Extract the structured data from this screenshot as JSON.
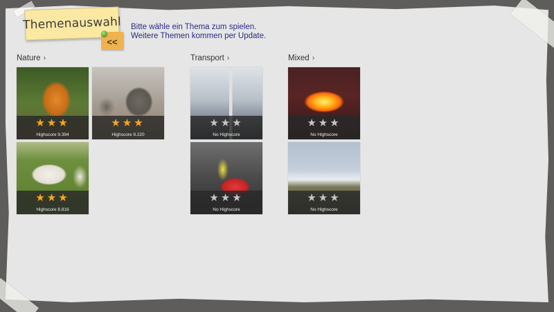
{
  "header": {
    "title": "Themenauswahl",
    "back_label": "<<",
    "intro_line1": "Bitte wähle ein Thema zum spielen.",
    "intro_line2": "Weitere Themen kommen per Update."
  },
  "categories": [
    {
      "name": "Nature",
      "chevron": "›",
      "tiles": [
        {
          "image": "tiger",
          "stars_earned": 3,
          "stars_total": 3,
          "score_text": "Highscore 9.394"
        },
        {
          "image": "elephants",
          "stars_earned": 3,
          "stars_total": 3,
          "score_text": "Highscore 9.220"
        },
        {
          "image": "sheep",
          "stars_earned": 3,
          "stars_total": 3,
          "score_text": "Highscore 8.816"
        }
      ]
    },
    {
      "name": "Transport",
      "chevron": "›",
      "tiles": [
        {
          "image": "chairlift",
          "stars_earned": 0,
          "stars_total": 3,
          "score_text": "No Highscore"
        },
        {
          "image": "toy-bike",
          "stars_earned": 0,
          "stars_total": 3,
          "score_text": "No Highscore"
        }
      ]
    },
    {
      "name": "Mixed",
      "chevron": "›",
      "tiles": [
        {
          "image": "fire-breather",
          "stars_earned": 0,
          "stars_total": 3,
          "score_text": "No Highscore"
        },
        {
          "image": "savanna-tree",
          "stars_earned": 0,
          "stars_total": 3,
          "score_text": "No Highscore"
        }
      ]
    }
  ],
  "colors": {
    "background": "#5e5d5b",
    "paper": "#e6e6e6",
    "note": "#fbe9a3",
    "back_note": "#f0b24e",
    "intro_text": "#2a2a88",
    "star_gold": "#f5a623",
    "star_grey": "#c6c6c6"
  }
}
